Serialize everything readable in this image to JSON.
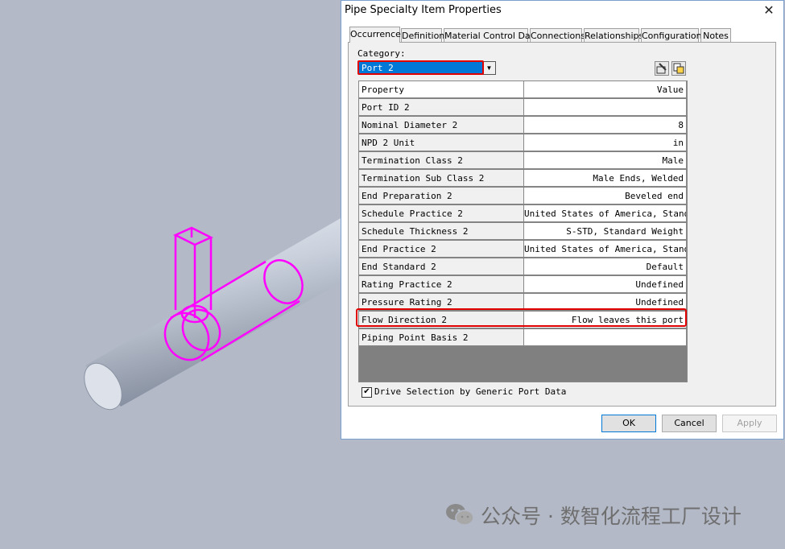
{
  "dialog": {
    "title": "Pipe Specialty Item Properties",
    "close_glyph": "✕",
    "tabs": [
      "Occurrence",
      "Definition",
      "Material Control Data",
      "Connections",
      "Relationships",
      "Configuration",
      "Notes"
    ],
    "active_tab": "Occurrence",
    "category_label": "Category:",
    "category_value": "Port 2",
    "grid": {
      "headers": {
        "property": "Property",
        "value": "Value"
      },
      "rows": [
        {
          "property": "Port ID 2",
          "value": ""
        },
        {
          "property": "Nominal Diameter 2",
          "value": "8"
        },
        {
          "property": "NPD 2 Unit",
          "value": "in"
        },
        {
          "property": "Termination Class 2",
          "value": "Male"
        },
        {
          "property": "Termination Sub Class 2",
          "value": "Male Ends, Welded"
        },
        {
          "property": "End Preparation 2",
          "value": "Beveled end"
        },
        {
          "property": "Schedule Practice 2",
          "value": "United States of America, Standards"
        },
        {
          "property": "Schedule Thickness 2",
          "value": "S-STD, Standard Weight"
        },
        {
          "property": "End Practice 2",
          "value": "United States of America, Standards"
        },
        {
          "property": "End Standard 2",
          "value": "Default"
        },
        {
          "property": "Rating Practice 2",
          "value": "Undefined"
        },
        {
          "property": "Pressure Rating 2",
          "value": "Undefined"
        },
        {
          "property": "Flow Direction 2",
          "value": "Flow leaves this port"
        },
        {
          "property": "Piping Point Basis 2",
          "value": ""
        }
      ]
    },
    "drive_selection_label": "Drive Selection by Generic Port Data",
    "drive_selection_checked": true,
    "buttons": {
      "ok": "OK",
      "cancel": "Cancel",
      "apply": "Apply"
    }
  },
  "watermark": {
    "text": "公众号 · 数智化流程工厂设计",
    "icon": "wechat-icon"
  },
  "colors": {
    "accent": "#0078d7",
    "highlight": "#e00000",
    "model_magenta": "#ff00ff",
    "background": "#b3b9c7"
  }
}
